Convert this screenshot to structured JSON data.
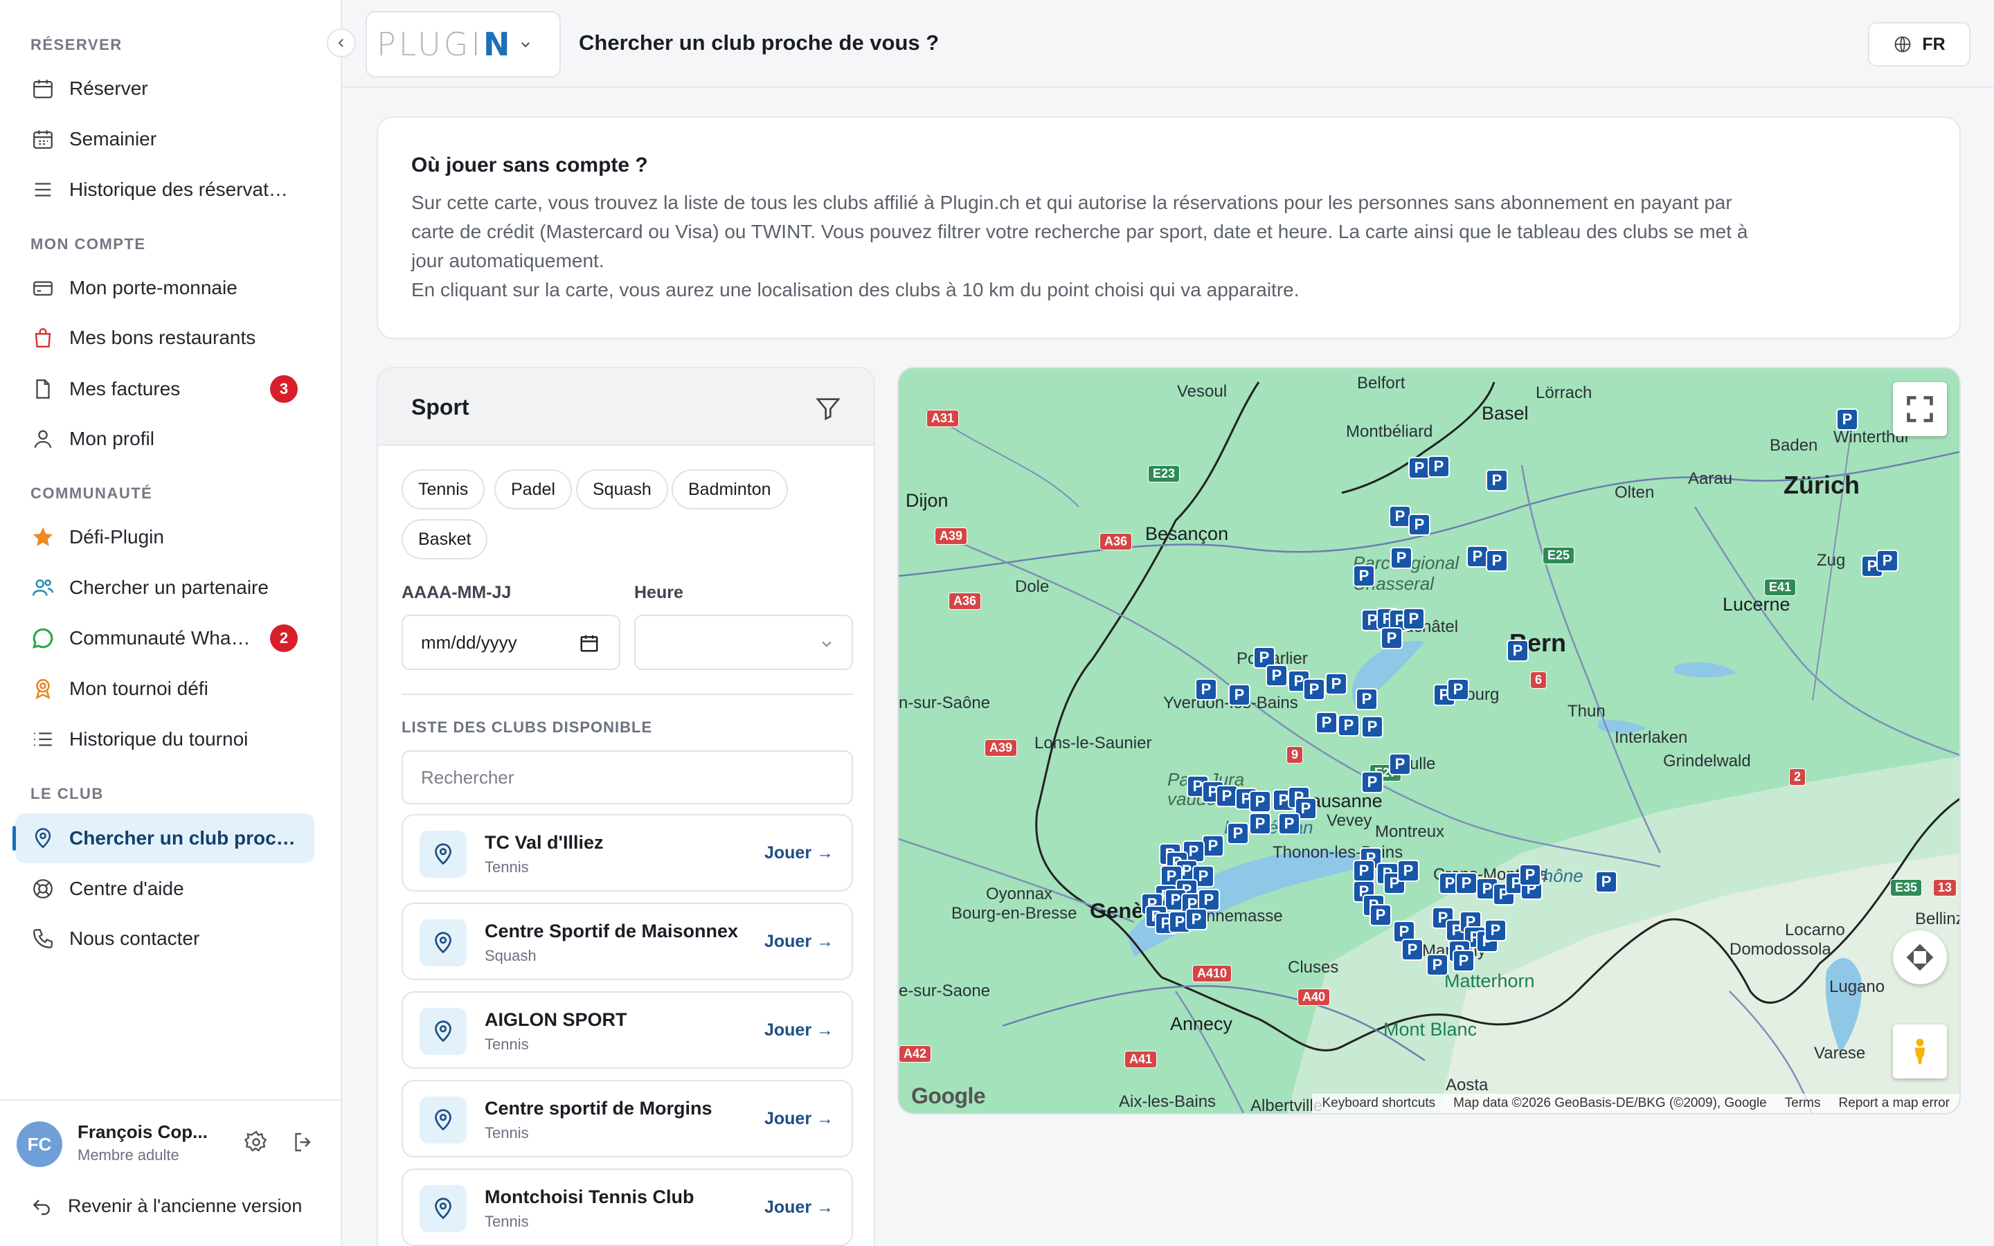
{
  "sidebar": {
    "sections": {
      "reserve": "RÉSERVER",
      "account": "MON COMPTE",
      "community": "COMMUNAUTÉ",
      "club": "LE CLUB"
    },
    "items": {
      "reserver": "Réserver",
      "semainier": "Semainier",
      "historique_reservations": "Historique des réservations",
      "porte_monnaie": "Mon porte-monnaie",
      "bons_restaurants": "Mes bons restaurants",
      "factures": "Mes factures",
      "factures_badge": "3",
      "profil": "Mon profil",
      "defi_plugin": "Défi-Plugin",
      "chercher_partenaire": "Chercher un partenaire",
      "communaute_whatsapp": "Communauté WhatsApp",
      "communaute_badge": "2",
      "tournoi_defi": "Mon tournoi défi",
      "historique_tournoi": "Historique du tournoi",
      "chercher_club": "Chercher un club proche de vous",
      "centre_aide": "Centre d'aide",
      "nous_contacter": "Nous contacter"
    },
    "user": {
      "initials": "FC",
      "name": "François Cop...",
      "role": "Membre adulte"
    },
    "back_link": "Revenir à l'ancienne version"
  },
  "header": {
    "logo": "PLUGIN",
    "title": "Chercher un club proche de vous ?",
    "language": "FR"
  },
  "info": {
    "title": "Où jouer sans compte ?",
    "line1": "Sur cette carte, vous trouvez la liste de tous les clubs affilié à Plugin.ch et qui autorise la réservations pour les personnes sans abonnement en payant par",
    "line2": "carte de crédit (Mastercard ou Visa) ou TWINT. Vous pouvez filtrer votre recherche par sport, date et heure. La carte ainsi que le tableau des clubs se met à",
    "line3": "jour automatiquement.",
    "line4": "En cliquant sur la carte, vous aurez une localisation des clubs à 10 km du point choisi qui va apparaitre."
  },
  "filters": {
    "title": "Sport",
    "sports": [
      "Tennis",
      "Padel",
      "Squash",
      "Badminton",
      "Basket"
    ],
    "date_label": "AAAA-MM-JJ",
    "date_value": "mm/dd/yyyy",
    "hour_label": "Heure",
    "list_title": "LISTE DES CLUBS DISPONIBLE",
    "search_placeholder": "Rechercher"
  },
  "clubs": [
    {
      "name": "TC Val d'Illiez",
      "sport": "Tennis",
      "action": "Jouer →"
    },
    {
      "name": "Centre Sportif de Maisonnex",
      "sport": "Squash",
      "action": "Jouer →"
    },
    {
      "name": "AIGLON SPORT",
      "sport": "Tennis",
      "action": "Jouer →"
    },
    {
      "name": "Centre sportif de Morgins",
      "sport": "Tennis",
      "action": "Jouer →"
    },
    {
      "name": "Montchoisi Tennis Club",
      "sport": "Tennis",
      "action": "Jouer →"
    }
  ],
  "map": {
    "labels": {
      "vesoul": "Vesoul",
      "belfort": "Belfort",
      "lorrach": "Lörrach",
      "basel": "Basel",
      "montbeliard": "Montbéliard",
      "baden": "Baden",
      "winterthur": "Winterthur",
      "zurich": "Zürich",
      "aarau": "Aarau",
      "olten": "Olten",
      "dijon": "Dijon",
      "besancon": "Besançon",
      "dole": "Dole",
      "chasseral": "Parc régional Chasseral",
      "neuchatel": "Neuchâtel",
      "bern": "Bern",
      "zug": "Zug",
      "lucerne": "Lucerne",
      "pontarlier": "Pontarlier",
      "fribourg": "Fribourg",
      "thun": "Thun",
      "yverdon": "Yverdon-les-Bains",
      "chalon": "n-sur-Saône",
      "lons": "Lons-le-Saunier",
      "interlaken": "Interlaken",
      "grindelwald": "Grindelwald",
      "bulle": "Bulle",
      "jura": "Parc Jura vaudois",
      "lausanne": "Lausanne",
      "lac": "Lac Léman",
      "vevey": "Vevey",
      "montreux": "Montreux",
      "thonon": "Thonon-les-Bains",
      "oyonnax": "Oyonnax",
      "bourg": "Bourg-en-Bresse",
      "geneve": "Genève",
      "annemasse": "Annemasse",
      "montana": "Crans-Montana",
      "rhone": "Rhône",
      "locarno": "Locarno",
      "domodossola": "Domodossola",
      "bellinzona": "Bellinzona",
      "lugano": "Lugano",
      "cluses": "Cluses",
      "martigny": "Martigny",
      "matterhorn": "Matterhorn",
      "annecy": "Annecy",
      "montblanc": "Mont Blanc",
      "varese": "Varese",
      "aosta": "Aosta",
      "aixlesbains": "Aix-les-Bains",
      "albertville": "Albertville",
      "villefranche": "e-sur-Saone"
    },
    "roads": [
      "A31",
      "E23",
      "A39",
      "A36",
      "A36",
      "E25",
      "E41",
      "6",
      "9",
      "E27",
      "2",
      "A39",
      "13",
      "E35",
      "A410",
      "A40",
      "A41",
      "A42"
    ],
    "attribution": {
      "shortcuts": "Keyboard shortcuts",
      "data": "Map data ©2026 GeoBasis-DE/BKG (©2009), Google",
      "terms": "Terms",
      "report": "Report a map error"
    },
    "google": "Google",
    "marker_icon": "P"
  }
}
